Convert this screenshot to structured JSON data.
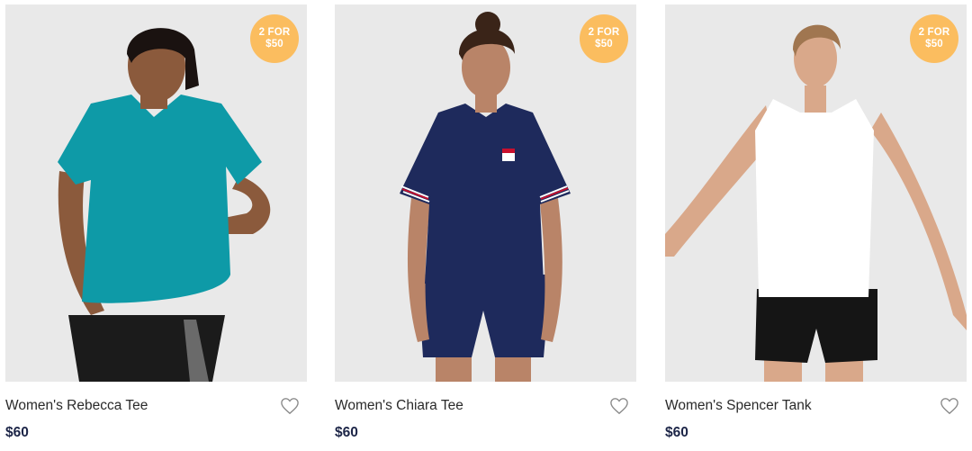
{
  "products": [
    {
      "name": "Women's Rebecca Tee",
      "price": "$60",
      "badge_line1": "2 FOR",
      "badge_line2": "$50",
      "favorite_icon": "heart-outline-icon",
      "garment_color": "#0e9aa7",
      "shorts_color": "#1b1b1b"
    },
    {
      "name": "Women's Chiara Tee",
      "price": "$60",
      "badge_line1": "2 FOR",
      "badge_line2": "$50",
      "favorite_icon": "heart-outline-icon",
      "garment_color": "#1e2a5c",
      "shorts_color": "#1e2a5c"
    },
    {
      "name": "Women's Spencer Tank",
      "price": "$60",
      "badge_line1": "2 FOR",
      "badge_line2": "$50",
      "favorite_icon": "heart-outline-icon",
      "garment_color": "#ffffff",
      "shorts_color": "#151515"
    }
  ],
  "colors": {
    "badge": "#fbbd5f",
    "price": "#1c2547",
    "photo_background": "#e9e9e9"
  }
}
